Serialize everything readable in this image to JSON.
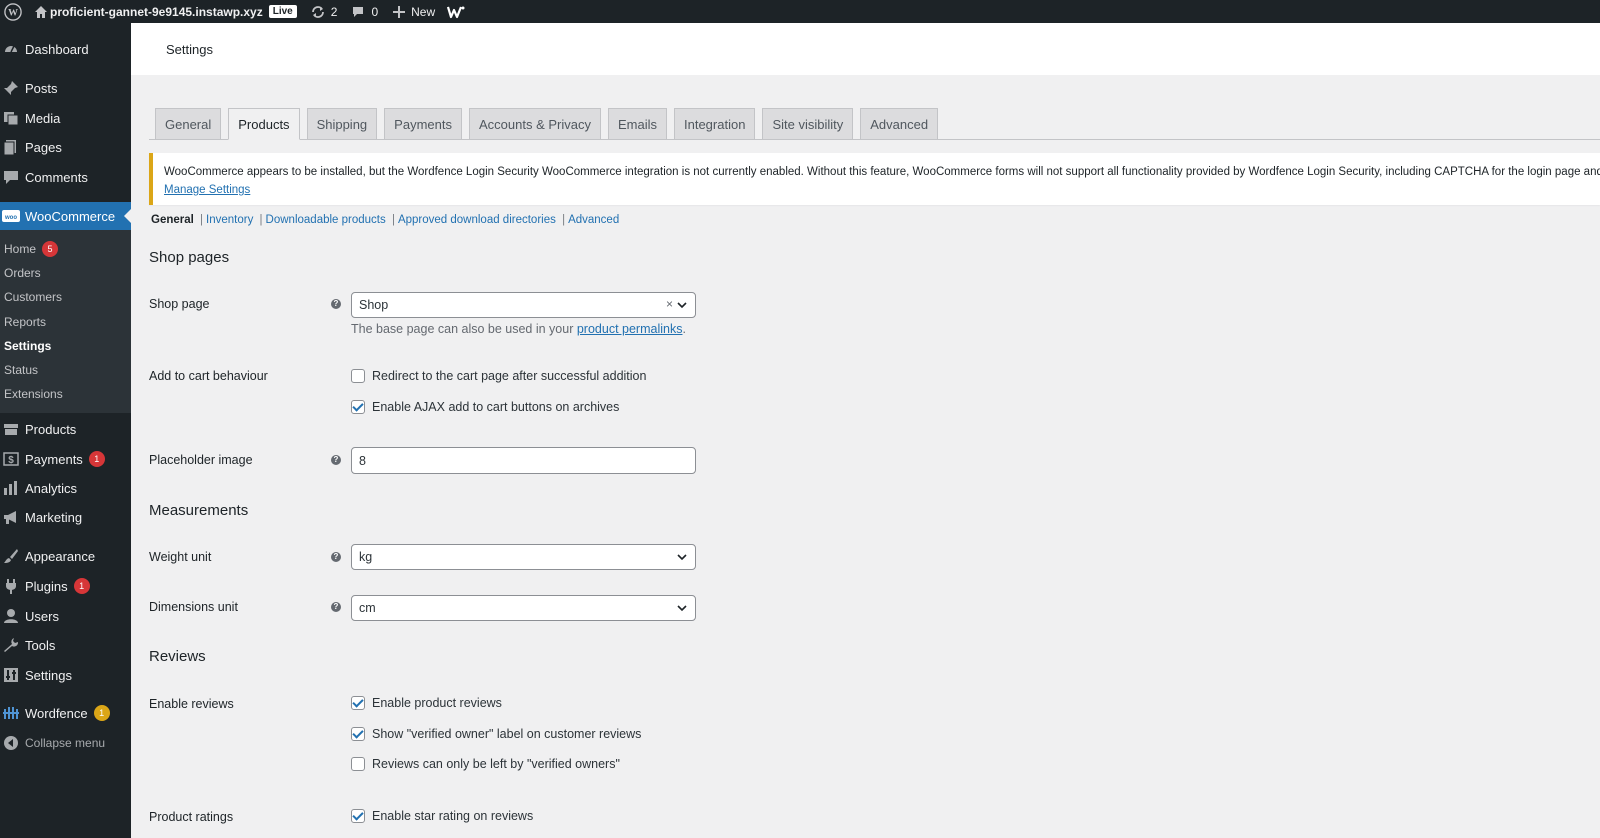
{
  "adminbar": {
    "site_name": "proficient-gannet-9e9145.instawp.xyz",
    "live_label": "Live",
    "updates_count": "2",
    "comments_count": "0",
    "new_label": "New"
  },
  "sidebar": {
    "items": {
      "dashboard": "Dashboard",
      "posts": "Posts",
      "media": "Media",
      "pages": "Pages",
      "comments": "Comments",
      "woocommerce": "WooCommerce",
      "products": "Products",
      "payments": "Payments",
      "payments_badge": "1",
      "analytics": "Analytics",
      "marketing": "Marketing",
      "appearance": "Appearance",
      "plugins": "Plugins",
      "plugins_badge": "1",
      "users": "Users",
      "tools": "Tools",
      "settings": "Settings",
      "wordfence": "Wordfence",
      "wordfence_badge": "1",
      "collapse": "Collapse menu"
    },
    "woo_submenu": {
      "home": "Home",
      "home_badge": "5",
      "orders": "Orders",
      "customers": "Customers",
      "reports": "Reports",
      "settings": "Settings",
      "status": "Status",
      "extensions": "Extensions"
    },
    "woo_logo_text": "woo"
  },
  "header": {
    "title": "Settings"
  },
  "tabs": {
    "general": "General",
    "products": "Products",
    "shipping": "Shipping",
    "payments": "Payments",
    "accounts": "Accounts & Privacy",
    "emails": "Emails",
    "integration": "Integration",
    "site_visibility": "Site visibility",
    "advanced": "Advanced"
  },
  "notice": {
    "text": "WooCommerce appears to be installed, but the Wordfence Login Security WooCommerce integration is not currently enabled. Without this feature, WooCommerce forms will not support all functionality provided by Wordfence Login Security, including CAPTCHA for the login page and",
    "link": "Manage Settings"
  },
  "subnav": {
    "general": "General",
    "inventory": "Inventory",
    "downloadable": "Downloadable products",
    "approved": "Approved download directories",
    "advanced": "Advanced",
    "separator": "|"
  },
  "form": {
    "shop_pages_title": "Shop pages",
    "shop_page_label": "Shop page",
    "shop_page_value": "Shop",
    "shop_page_desc_prefix": "The base page can also be used in your ",
    "shop_page_desc_link": "product permalinks",
    "shop_page_desc_suffix": ".",
    "add_to_cart_label": "Add to cart behaviour",
    "redirect_label": "Redirect to the cart page after successful addition",
    "redirect_checked": false,
    "ajax_label": "Enable AJAX add to cart buttons on archives",
    "ajax_checked": true,
    "placeholder_label": "Placeholder image",
    "placeholder_value": "8",
    "measurements_title": "Measurements",
    "weight_label": "Weight unit",
    "weight_value": "kg",
    "dimensions_label": "Dimensions unit",
    "dimensions_value": "cm",
    "reviews_title": "Reviews",
    "enable_reviews_label": "Enable reviews",
    "enable_product_reviews": "Enable product reviews",
    "enable_product_reviews_checked": true,
    "verified_owner_label": "Show \"verified owner\" label on customer reviews",
    "verified_owner_checked": true,
    "only_verified_label": "Reviews can only be left by \"verified owners\"",
    "only_verified_checked": false,
    "product_ratings_label": "Product ratings",
    "star_rating_label": "Enable star rating on reviews",
    "star_rating_checked": true
  },
  "colors": {
    "admin_dark": "#1d2327",
    "accent_blue": "#2271b1",
    "notice_yellow": "#dba617",
    "badge_red": "#d63638"
  }
}
